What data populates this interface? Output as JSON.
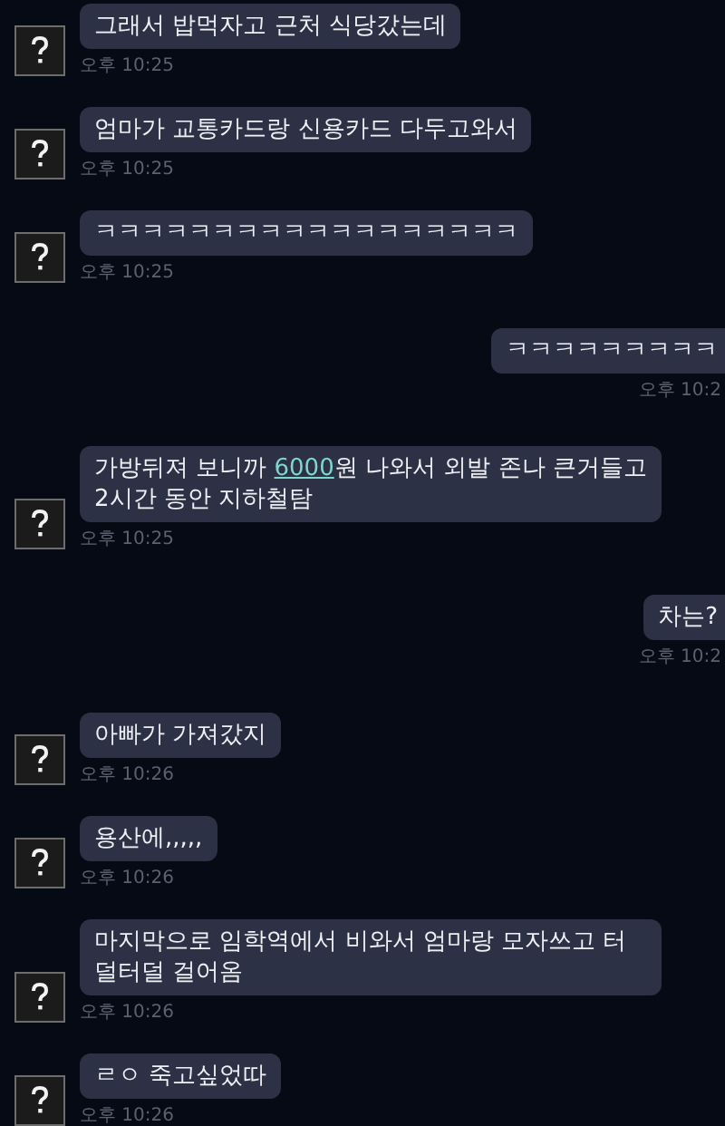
{
  "messages": [
    {
      "kind": "received",
      "parts": [
        {
          "kind": "plain",
          "text": "그래서 밥먹자고 근처 식당갔는데"
        }
      ],
      "time": "오후 10:25"
    },
    {
      "kind": "received",
      "parts": [
        {
          "kind": "plain",
          "text": "엄마가 교통카드랑 신용카드 다두고와서"
        }
      ],
      "time": "오후 10:25"
    },
    {
      "kind": "received",
      "parts": [
        {
          "kind": "plain",
          "text": "ㅋㅋㅋㅋㅋㅋㅋㅋㅋㅋㅋㅋㅋㅋㅋㅋㅋㅋ"
        }
      ],
      "time": "오후 10:25"
    },
    {
      "kind": "sent",
      "parts": [
        {
          "kind": "plain",
          "text": "ㅋㅋㅋㅋㅋㅋㅋㅋㅋ"
        }
      ],
      "time": "오후 10:2"
    },
    {
      "kind": "received",
      "parts": [
        {
          "kind": "plain",
          "text": "가방뒤져 보니까 "
        },
        {
          "kind": "link",
          "text": "6000"
        },
        {
          "kind": "plain",
          "text": "원 나와서 외발 존나 큰거들고 2시간 동안 지하철탐"
        }
      ],
      "time": "오후 10:25"
    },
    {
      "kind": "sent",
      "parts": [
        {
          "kind": "plain",
          "text": "차는?"
        }
      ],
      "time": "오후 10:2"
    },
    {
      "kind": "received",
      "parts": [
        {
          "kind": "plain",
          "text": "아빠가 가져갔지"
        }
      ],
      "time": "오후 10:26"
    },
    {
      "kind": "received",
      "parts": [
        {
          "kind": "plain",
          "text": "용산에,,,,,"
        }
      ],
      "time": "오후 10:26"
    },
    {
      "kind": "received",
      "parts": [
        {
          "kind": "plain",
          "text": "마지막으로 임학역에서 비와서 엄마랑 모자쓰고 터덜터덜 걸어옴"
        }
      ],
      "time": "오후 10:26"
    },
    {
      "kind": "received",
      "parts": [
        {
          "kind": "plain",
          "text": "ㄹㅇ 죽고싶었따"
        }
      ],
      "time": "오후 10:26"
    }
  ]
}
